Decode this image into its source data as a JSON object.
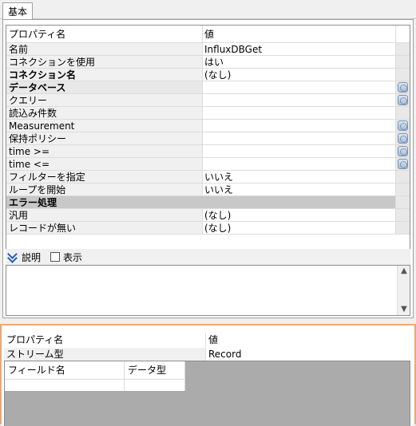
{
  "tabs": {
    "basic": "基本"
  },
  "grid": {
    "col_name": "プロパティ名",
    "col_value": "値",
    "rows": [
      {
        "name": "名前",
        "value": "InfluxDBGet"
      },
      {
        "name": "コネクションを使用",
        "value": "はい"
      },
      {
        "name": "コネクション名",
        "value": "(なし)"
      },
      {
        "name": "データベース",
        "value": ""
      },
      {
        "name": "クエリー",
        "value": ""
      },
      {
        "name": "読込み件数",
        "value": ""
      },
      {
        "name": "Measurement",
        "value": ""
      },
      {
        "name": "保持ポリシー",
        "value": ""
      },
      {
        "name": "time >=",
        "value": ""
      },
      {
        "name": "time <=",
        "value": ""
      },
      {
        "name": "フィルターを指定",
        "value": "いいえ"
      },
      {
        "name": "ループを開始",
        "value": "いいえ"
      },
      {
        "name": "エラー処理",
        "value": ""
      },
      {
        "name": "汎用",
        "value": "(なし)"
      },
      {
        "name": "レコードが無い",
        "value": "(なし)"
      }
    ]
  },
  "description": {
    "label": "説明",
    "show_label": "表示"
  },
  "bottom": {
    "col_name": "プロパティ名",
    "col_value": "値",
    "stream_type_label": "ストリーム型",
    "stream_type_value": "Record",
    "field_name_header": "フィールド名",
    "data_type_header": "データ型"
  },
  "colors": {
    "group_row": "#c8c8c8",
    "accent_border": "#e8a878"
  }
}
